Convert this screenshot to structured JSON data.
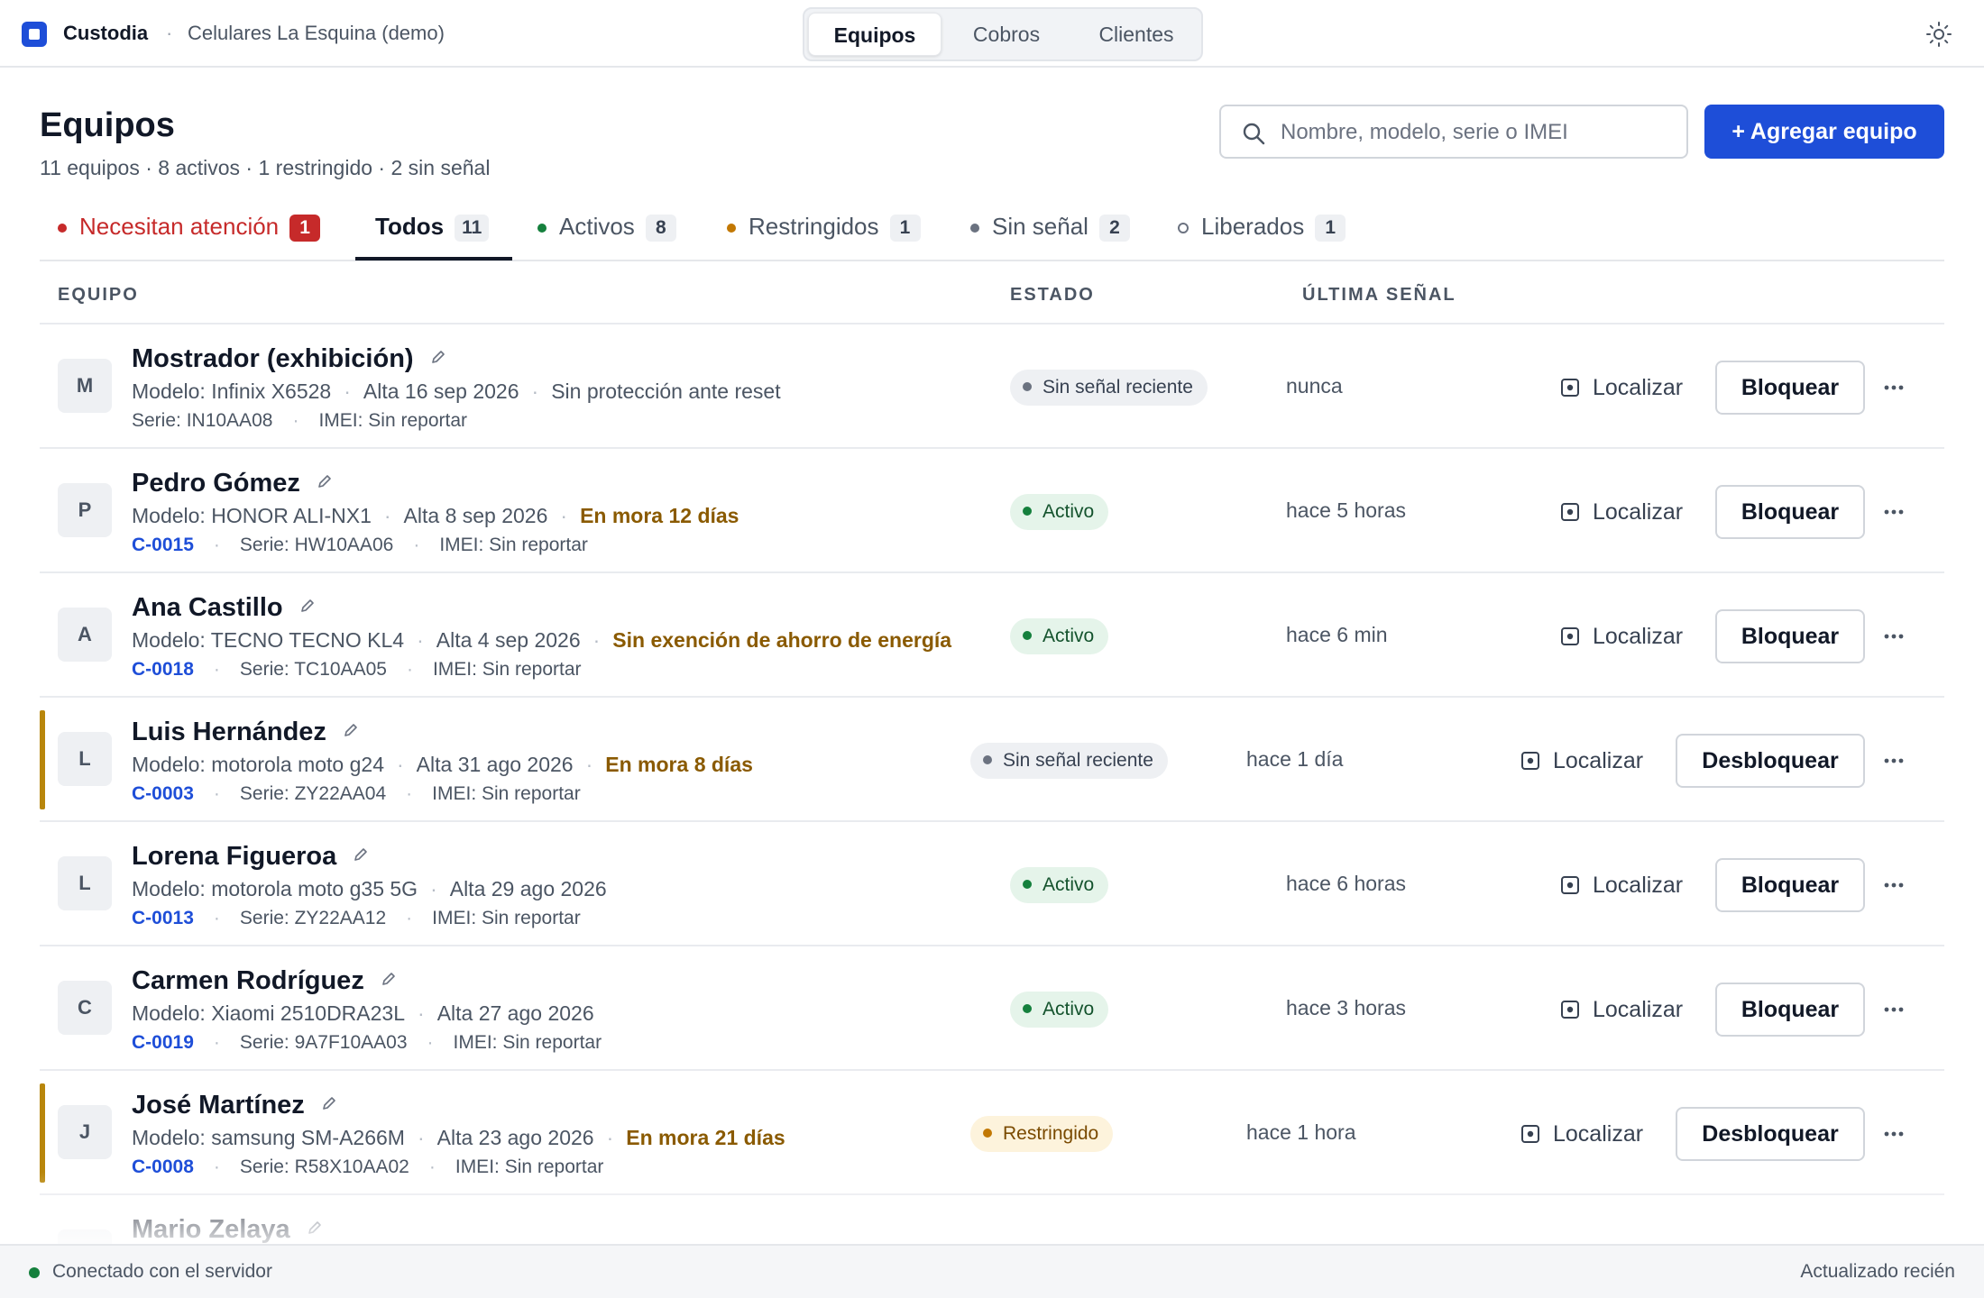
{
  "topbar": {
    "app_name": "Custodia",
    "separator": "·",
    "store_name": "Celulares La Esquina (demo)",
    "nav": [
      {
        "label": "Equipos",
        "active": true
      },
      {
        "label": "Cobros",
        "active": false
      },
      {
        "label": "Clientes",
        "active": false
      }
    ],
    "theme_icon": "sun-icon"
  },
  "header": {
    "title": "Equipos",
    "subtitle": "11 equipos · 8 activos · 1 restringido · 2 sin señal",
    "search_placeholder": "Nombre, modelo, serie o IMEI",
    "add_button": "+ Agregar equipo"
  },
  "tabs": [
    {
      "label": "Necesitan atención",
      "count": "1",
      "marker": "red-dot",
      "active": false
    },
    {
      "label": "Todos",
      "count": "11",
      "marker": "none",
      "active": true
    },
    {
      "label": "Activos",
      "count": "8",
      "marker": "green-dot",
      "active": false
    },
    {
      "label": "Restringidos",
      "count": "1",
      "marker": "amber-dot",
      "active": false
    },
    {
      "label": "Sin señal",
      "count": "2",
      "marker": "grey-dot",
      "active": false
    },
    {
      "label": "Liberados",
      "count": "1",
      "marker": "ring",
      "active": false
    }
  ],
  "table": {
    "headers": {
      "device": "EQUIPO",
      "status": "ESTADO",
      "last_signal": "ÚLTIMA SEÑAL"
    },
    "locate_label": "Localizar",
    "rows": [
      {
        "initial": "M",
        "name": "Mostrador (exhibición)",
        "model": "Modelo: Infinix X6528",
        "registered": "Alta 16 sep 2026",
        "note": "Sin protección ante reset",
        "note_warn": false,
        "code": "",
        "serial": "Serie: IN10AA08",
        "imei": "IMEI: Sin reportar",
        "status": "Sin señal reciente",
        "status_kind": "grey",
        "last_signal": "nunca",
        "action": "Bloquear",
        "flagged": false
      },
      {
        "initial": "P",
        "name": "Pedro Gómez",
        "model": "Modelo: HONOR ALI-NX1",
        "registered": "Alta 8 sep 2026",
        "note": "En mora 12 días",
        "note_warn": true,
        "code": "C-0015",
        "serial": "Serie: HW10AA06",
        "imei": "IMEI: Sin reportar",
        "status": "Activo",
        "status_kind": "green",
        "last_signal": "hace 5 horas",
        "action": "Bloquear",
        "flagged": false
      },
      {
        "initial": "A",
        "name": "Ana Castillo",
        "model": "Modelo: TECNO TECNO KL4",
        "registered": "Alta 4 sep 2026",
        "note": "Sin exención de ahorro de energía",
        "note_warn": true,
        "code": "C-0018",
        "serial": "Serie: TC10AA05",
        "imei": "IMEI: Sin reportar",
        "status": "Activo",
        "status_kind": "green",
        "last_signal": "hace 6 min",
        "action": "Bloquear",
        "flagged": false
      },
      {
        "initial": "L",
        "name": "Luis Hernández",
        "model": "Modelo: motorola moto g24",
        "registered": "Alta 31 ago 2026",
        "note": "En mora 8 días",
        "note_warn": true,
        "code": "C-0003",
        "serial": "Serie: ZY22AA04",
        "imei": "IMEI: Sin reportar",
        "status": "Sin señal reciente",
        "status_kind": "grey",
        "last_signal": "hace 1 día",
        "action": "Desbloquear",
        "flagged": true
      },
      {
        "initial": "L",
        "name": "Lorena Figueroa",
        "model": "Modelo: motorola moto g35 5G",
        "registered": "Alta 29 ago 2026",
        "note": "",
        "note_warn": false,
        "code": "C-0013",
        "serial": "Serie: ZY22AA12",
        "imei": "IMEI: Sin reportar",
        "status": "Activo",
        "status_kind": "green",
        "last_signal": "hace 6 horas",
        "action": "Bloquear",
        "flagged": false
      },
      {
        "initial": "C",
        "name": "Carmen Rodríguez",
        "model": "Modelo: Xiaomi 2510DRA23L",
        "registered": "Alta 27 ago 2026",
        "note": "",
        "note_warn": false,
        "code": "C-0019",
        "serial": "Serie: 9A7F10AA03",
        "imei": "IMEI: Sin reportar",
        "status": "Activo",
        "status_kind": "green",
        "last_signal": "hace 3 horas",
        "action": "Bloquear",
        "flagged": false
      },
      {
        "initial": "J",
        "name": "José Martínez",
        "model": "Modelo: samsung SM-A266M",
        "registered": "Alta 23 ago 2026",
        "note": "En mora 21 días",
        "note_warn": true,
        "code": "C-0008",
        "serial": "Serie: R58X10AA02",
        "imei": "IMEI: Sin reportar",
        "status": "Restringido",
        "status_kind": "amber",
        "last_signal": "hace 1 hora",
        "action": "Desbloquear",
        "flagged": true
      },
      {
        "initial": "",
        "name": "Mario Zelaya",
        "model": "",
        "registered": "",
        "note": "",
        "note_warn": false,
        "code": "",
        "serial": "",
        "imei": "",
        "status": "",
        "status_kind": "green",
        "last_signal": "",
        "action": "",
        "flagged": false,
        "partial": true
      }
    ]
  },
  "footer": {
    "connection": "Conectado con el servidor",
    "updated": "Actualizado recién"
  },
  "colors": {
    "accent": "#1e4ed8",
    "danger": "#c62a2a",
    "warning_text": "#8a5a00",
    "flag": "#b8860b",
    "active_green": "#15803d"
  }
}
